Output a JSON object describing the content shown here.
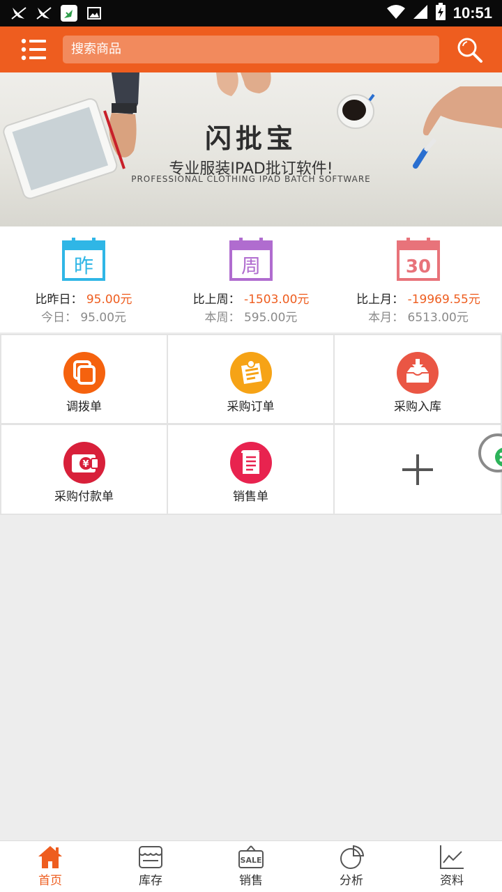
{
  "status_bar": {
    "time": "10:51",
    "icons": [
      "notification-bird-icon",
      "notification-bird-icon",
      "app-notification-icon",
      "image-notification-icon",
      "wifi-icon",
      "signal-icon",
      "battery-charging-icon"
    ]
  },
  "header": {
    "menu_icon": "list-menu-icon",
    "search_placeholder": "搜索商品",
    "search_icon": "search-icon",
    "colors": {
      "bar": "#ee5d1f",
      "search_bg": "#f28a5d"
    }
  },
  "banner": {
    "title": "闪批宝",
    "subtitle": "专业服装IPAD批订软件!",
    "subtitle_en": "PROFESSIONAL CLOTHING IPAD BATCH SOFTWARE"
  },
  "stats": [
    {
      "icon_char": "昨",
      "compare_label": "比昨日：",
      "compare_value": "95.00元",
      "current_label": "今日：",
      "current_value": "95.00元",
      "color": "#2fb6e6"
    },
    {
      "icon_char": "周",
      "compare_label": "比上周：",
      "compare_value": "-1503.00元",
      "current_label": "本周：",
      "current_value": "595.00元",
      "color": "#b06ccf"
    },
    {
      "icon_char": "30",
      "compare_label": "比上月：",
      "compare_value": "-19969.55元",
      "current_label": "本月：",
      "current_value": "6513.00元",
      "color": "#e8737a"
    }
  ],
  "functions": [
    {
      "label": "调拨单",
      "icon": "transfer-copy-icon",
      "color": "#f5620e"
    },
    {
      "label": "采购订单",
      "icon": "purchase-order-notepad-icon",
      "color": "#f6a316"
    },
    {
      "label": "采购入库",
      "icon": "inbox-download-icon",
      "color": "#ea5644"
    },
    {
      "label": "采购付款单",
      "icon": "payment-wallet-yen-icon",
      "color": "#d8203a"
    },
    {
      "label": "销售单",
      "icon": "sales-receipt-scroll-icon",
      "color": "#e8234f"
    },
    {
      "label": "",
      "icon": "add-plus-icon",
      "color": "#555555"
    }
  ],
  "bottom_nav": [
    {
      "label": "首页",
      "icon": "home-icon",
      "active": true
    },
    {
      "label": "库存",
      "icon": "store-inventory-icon",
      "active": false
    },
    {
      "label": "销售",
      "icon": "sale-tag-icon",
      "active": false
    },
    {
      "label": "分析",
      "icon": "pie-chart-icon",
      "active": false
    },
    {
      "label": "资料",
      "icon": "line-chart-icon",
      "active": false
    }
  ],
  "accent_color": "#ee5d1f"
}
